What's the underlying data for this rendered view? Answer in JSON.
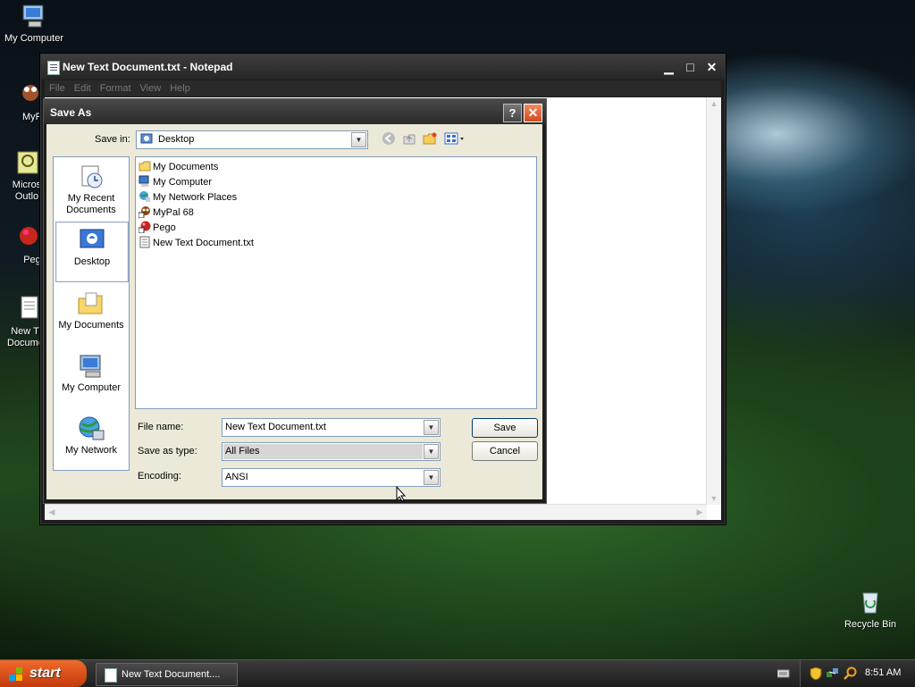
{
  "desktop": {
    "icons": [
      {
        "label": "My Computer"
      },
      {
        "label": "MyPa"
      },
      {
        "label": "Micros Outlo"
      },
      {
        "label": "Peg"
      },
      {
        "label": "New T Docume"
      },
      {
        "label": "Recycle Bin"
      }
    ]
  },
  "notepad": {
    "title": "New Text Document.txt - Notepad",
    "menu": [
      "File",
      "Edit",
      "Format",
      "View",
      "Help"
    ]
  },
  "dialog": {
    "title": "Save As",
    "help_label": "?",
    "save_in_label": "Save in:",
    "save_in_value": "Desktop",
    "places": [
      {
        "label": "My Recent Documents",
        "icon": "recent-documents-icon"
      },
      {
        "label": "Desktop",
        "icon": "desktop-icon"
      },
      {
        "label": "My Documents",
        "icon": "folder-icon"
      },
      {
        "label": "My Computer",
        "icon": "computer-icon"
      },
      {
        "label": "My Network",
        "icon": "network-icon"
      }
    ],
    "files": [
      {
        "name": "My Documents",
        "icon": "folder-icon"
      },
      {
        "name": "My Computer",
        "icon": "computer-icon"
      },
      {
        "name": "My Network Places",
        "icon": "network-icon"
      },
      {
        "name": "MyPal 68",
        "icon": "shortcut-icon"
      },
      {
        "name": "Pego",
        "icon": "shortcut-icon"
      },
      {
        "name": "New Text Document.txt",
        "icon": "text-file-icon"
      }
    ],
    "file_name_label": "File name:",
    "file_name_value": "New Text Document.txt",
    "save_as_type_label": "Save as type:",
    "save_as_type_value": "All Files",
    "encoding_label": "Encoding:",
    "encoding_value": "ANSI",
    "save_button": "Save",
    "cancel_button": "Cancel"
  },
  "taskbar": {
    "start_label": "start",
    "task_label": "New Text Document....",
    "clock": "8:51 AM"
  }
}
